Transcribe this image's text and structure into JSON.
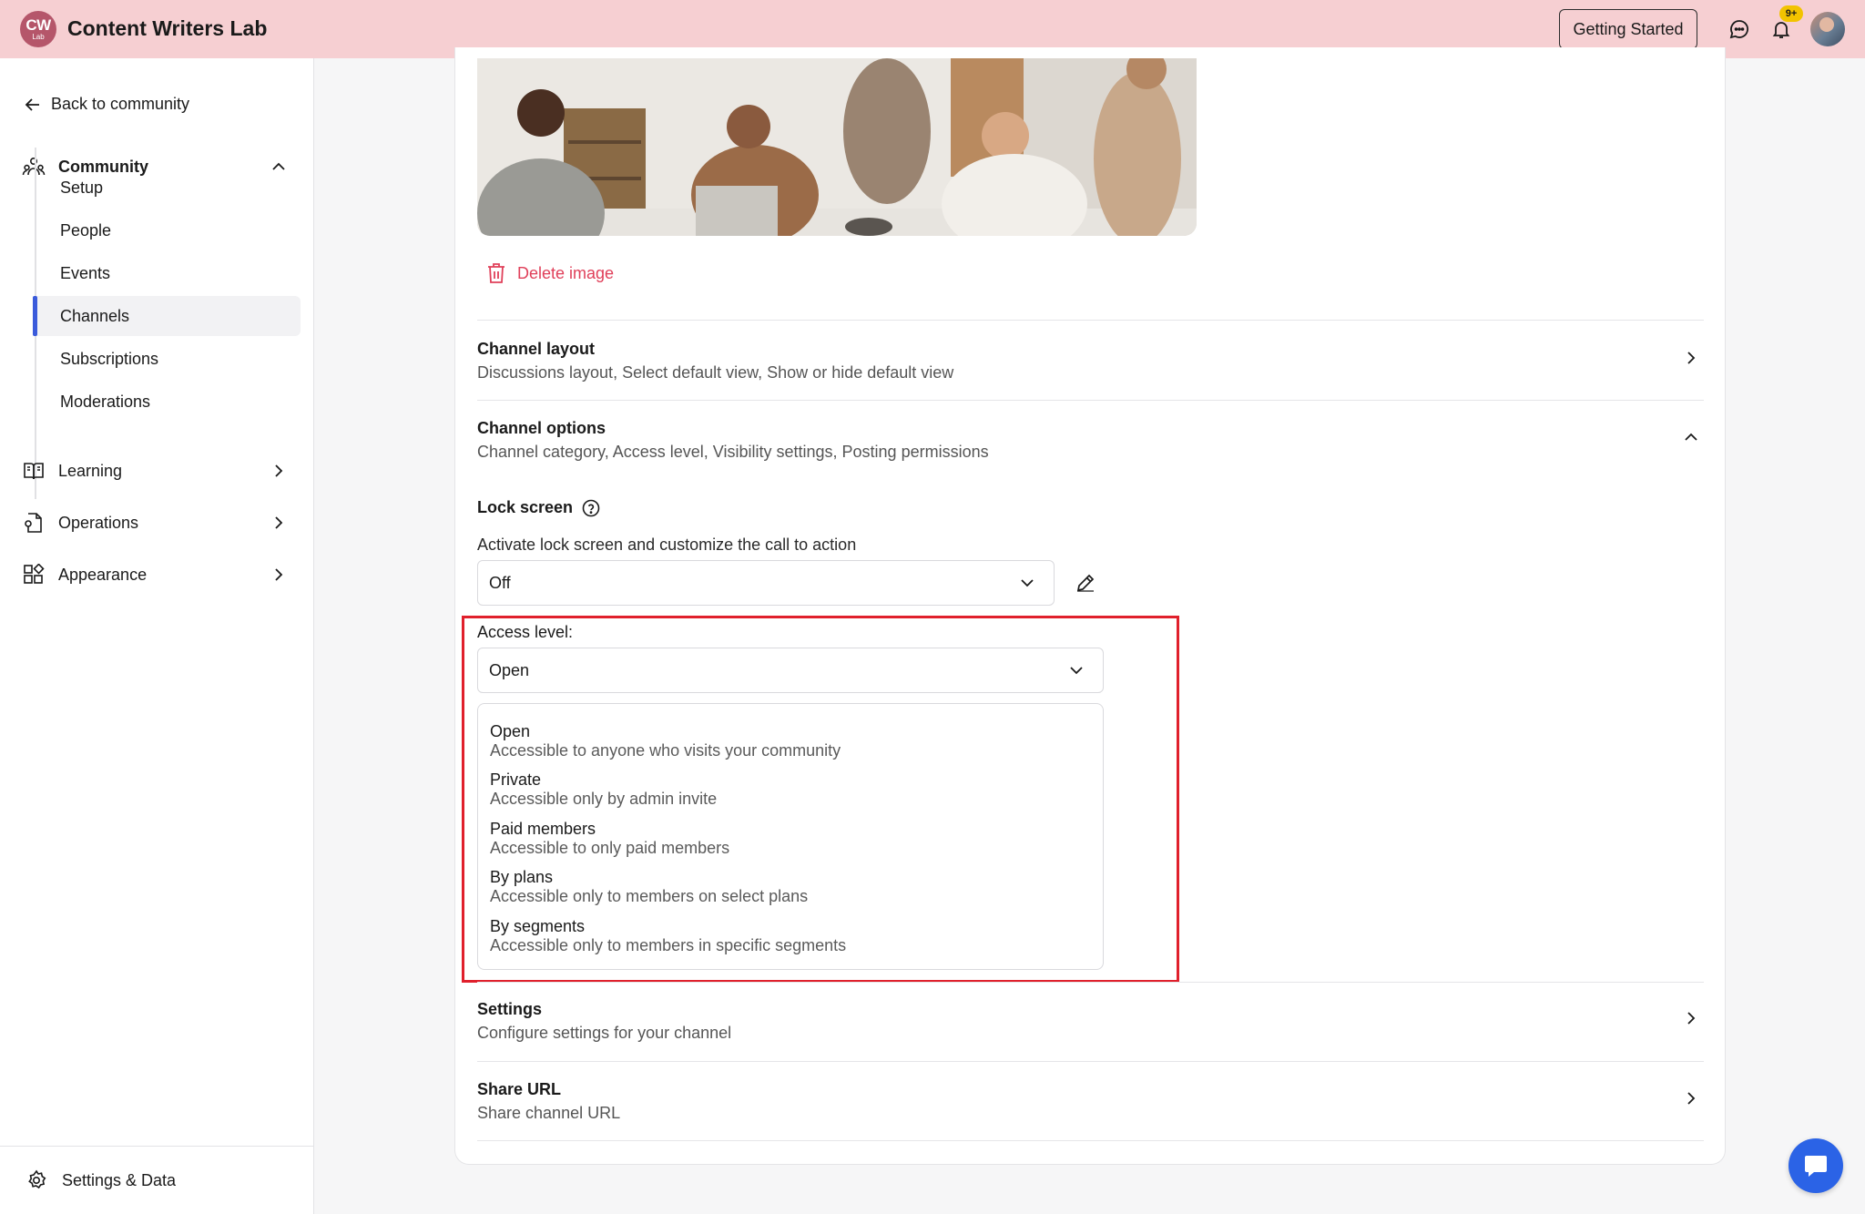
{
  "header": {
    "logo_main": "CW",
    "logo_sub": "Lab",
    "title": "Content Writers Lab",
    "getting_started": "Getting Started",
    "notification_count": "9+"
  },
  "sidebar": {
    "back": "Back to community",
    "community": {
      "label": "Community",
      "items": [
        "Setup",
        "People",
        "Events",
        "Channels",
        "Subscriptions",
        "Moderations"
      ],
      "active": "Channels"
    },
    "groups": [
      {
        "label": "Learning",
        "icon": "book-icon"
      },
      {
        "label": "Operations",
        "icon": "operations-icon"
      },
      {
        "label": "Appearance",
        "icon": "appearance-icon"
      }
    ],
    "bottom": "Settings & Data"
  },
  "main": {
    "delete_image": "Delete image",
    "sections": {
      "layout": {
        "title": "Channel layout",
        "subtitle": "Discussions layout, Select default view, Show or hide default view"
      },
      "options": {
        "title": "Channel options",
        "subtitle": "Channel category, Access level, Visibility settings, Posting permissions"
      },
      "settings": {
        "title": "Settings",
        "subtitle": "Configure settings for your channel"
      },
      "share": {
        "title": "Share URL",
        "subtitle": "Share channel URL"
      }
    },
    "lock_screen": {
      "title": "Lock screen",
      "description": "Activate lock screen and customize the call to action",
      "value": "Off"
    },
    "access_level": {
      "label": "Access level:",
      "value": "Open",
      "options": [
        {
          "title": "Open",
          "description": "Accessible to anyone who visits your community"
        },
        {
          "title": "Private",
          "description": "Accessible only by admin invite"
        },
        {
          "title": "Paid members",
          "description": "Accessible to only paid members"
        },
        {
          "title": "By plans",
          "description": "Accessible only to members on select plans"
        },
        {
          "title": "By segments",
          "description": "Accessible only to members in specific segments"
        }
      ]
    }
  },
  "colors": {
    "header_bg": "#f6cfd2",
    "accent": "#3b5bdb",
    "danger": "#e0405a",
    "highlight": "#e0202c",
    "fab": "#2b63e6"
  }
}
